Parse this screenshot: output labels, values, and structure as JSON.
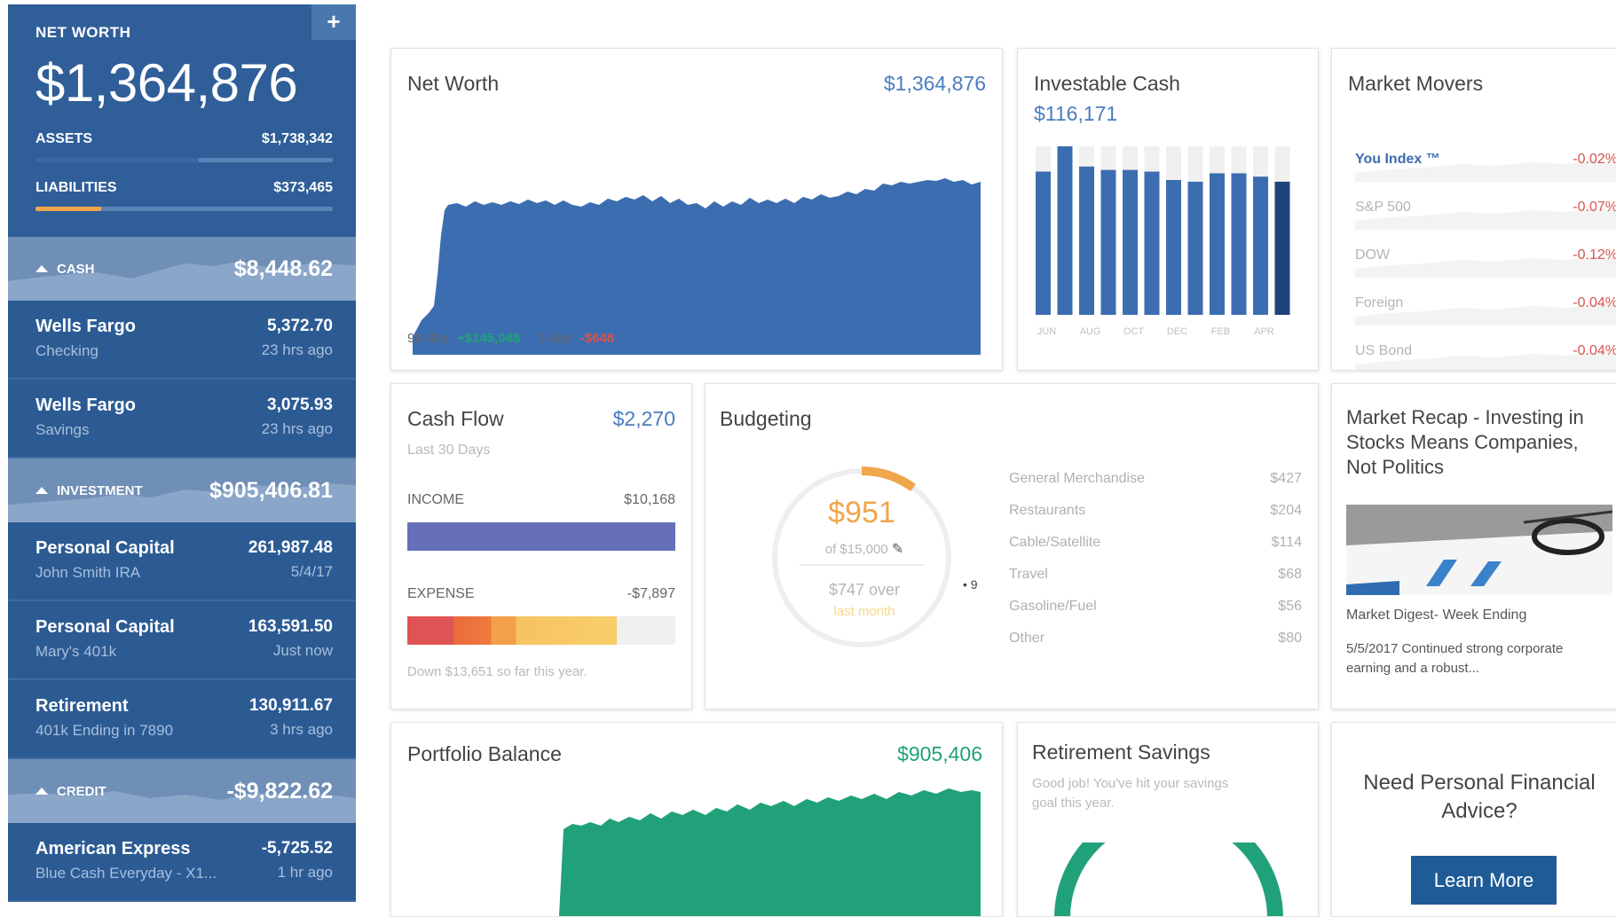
{
  "colors": {
    "brand_blue": "#3c6db0",
    "green": "#21a17a",
    "red": "#d9534f",
    "accent_text_blue": "#4a7cc0",
    "orange": "#f0a64a"
  },
  "sidebar": {
    "add_icon": "plus-icon",
    "net_worth_label": "NET WORTH",
    "net_worth_value": "$1,364,876",
    "assets_label": "ASSETS",
    "assets_value": "$1,738,342",
    "assets_fraction": 0.55,
    "liabilities_label": "LIABILITIES",
    "liabilities_value": "$373,465",
    "liabilities_fraction": 0.22,
    "groups": [
      {
        "label": "CASH",
        "value": "$8,448.62",
        "accounts": [
          {
            "name": "Wells Fargo",
            "sub": "Checking",
            "value": "5,372.70",
            "time": "23 hrs ago"
          },
          {
            "name": "Wells Fargo",
            "sub": "Savings",
            "value": "3,075.93",
            "time": "23 hrs ago"
          }
        ]
      },
      {
        "label": "INVESTMENT",
        "value": "$905,406.81",
        "accounts": [
          {
            "name": "Personal Capital",
            "sub": "John Smith IRA",
            "value": "261,987.48",
            "time": "5/4/17"
          },
          {
            "name": "Personal Capital",
            "sub": "Mary's 401k",
            "value": "163,591.50",
            "time": "Just now"
          },
          {
            "name": "Retirement",
            "sub": "401k Ending in 7890",
            "value": "130,911.67",
            "time": "3 hrs ago"
          }
        ]
      },
      {
        "label": "CREDIT",
        "value": "-$9,822.62",
        "accounts": [
          {
            "name": "American Express",
            "sub": "Blue Cash Everyday - X1...",
            "value": "-5,725.52",
            "time": "1 hr ago"
          }
        ]
      }
    ]
  },
  "net_worth_card": {
    "title": "Net Worth",
    "value": "$1,364,876",
    "period_90_label": "90-day",
    "period_90_change": "+$145,048",
    "period_1_label": "1-day",
    "period_1_change": "-$648"
  },
  "investable_cash": {
    "title": "Investable Cash",
    "value": "$116,171",
    "months": [
      "JUN",
      "AUG",
      "OCT",
      "DEC",
      "FEB",
      "APR"
    ],
    "bars": [
      0.85,
      1.0,
      0.88,
      0.86,
      0.86,
      0.85,
      0.8,
      0.79,
      0.84,
      0.84,
      0.82,
      0.79
    ]
  },
  "market_movers": {
    "title": "Market Movers",
    "rows": [
      {
        "name": "You Index ™",
        "change": "-0.02%",
        "highlight": true
      },
      {
        "name": "S&P 500",
        "change": "-0.07%",
        "highlight": false
      },
      {
        "name": "DOW",
        "change": "-0.12%",
        "highlight": false
      },
      {
        "name": "Foreign",
        "change": "-0.04%",
        "highlight": false
      },
      {
        "name": "US Bond",
        "change": "-0.04%",
        "highlight": false
      }
    ]
  },
  "cash_flow": {
    "title": "Cash Flow",
    "value": "$2,270",
    "subtitle": "Last 30 Days",
    "income_label": "INCOME",
    "income_value": "$10,168",
    "expense_label": "EXPENSE",
    "expense_value": "-$7,897",
    "expense_fraction": 0.78,
    "footer": "Down $13,651 so far this year."
  },
  "budgeting": {
    "title": "Budgeting",
    "spent": "$951",
    "of_budget": "of $15,000",
    "edit_icon": "pencil-icon",
    "over_text": "$747 over",
    "sub_text": "last month",
    "day_marker": "9",
    "ring_fraction": 0.08,
    "categories": [
      {
        "name": "General Merchandise",
        "amount": "$427"
      },
      {
        "name": "Restaurants",
        "amount": "$204"
      },
      {
        "name": "Cable/Satellite",
        "amount": "$114"
      },
      {
        "name": "Travel",
        "amount": "$68"
      },
      {
        "name": "Gasoline/Fuel",
        "amount": "$56"
      },
      {
        "name": "Other",
        "amount": "$80"
      }
    ]
  },
  "market_recap": {
    "title": "Market Recap - Investing in Stocks Means Companies, Not Politics",
    "caption": "Market Digest- Week Ending",
    "body": "5/5/2017 Continued strong corporate earning and a robust..."
  },
  "portfolio_balance": {
    "title": "Portfolio Balance",
    "value": "$905,406"
  },
  "retirement_savings": {
    "title": "Retirement Savings",
    "text": "Good job! You've hit your savings goal this year."
  },
  "advice": {
    "title": "Need Personal Financial Advice?",
    "button_label": "Learn More"
  }
}
